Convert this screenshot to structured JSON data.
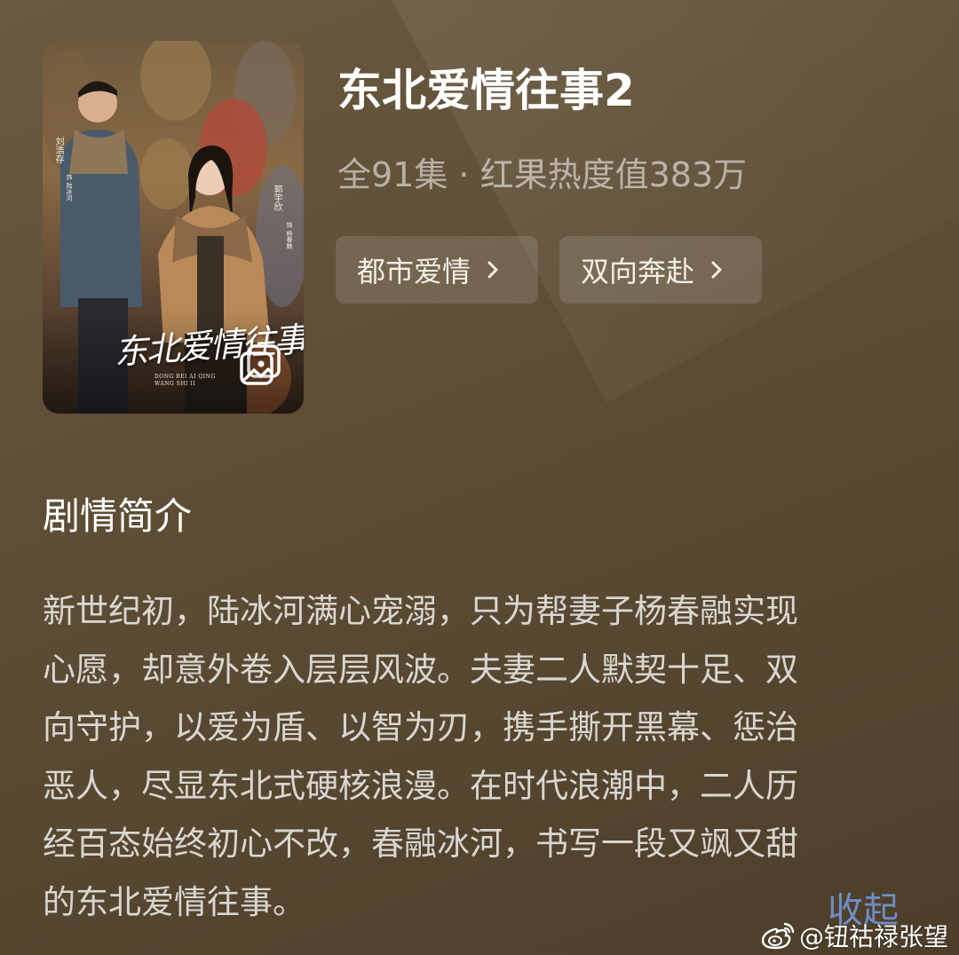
{
  "poster": {
    "title_art": "东北爱情往事2",
    "subtitle_art": "DONG BEI AI QING WANG SHI II",
    "cast_left": "刘浩存",
    "cast_left_role": "饰 陆冰河",
    "cast_right": "郭宇欣",
    "cast_right_role": "饰 杨春融",
    "gallery_icon": "gallery-icon"
  },
  "header": {
    "title": "东北爱情往事2",
    "meta": "全91集 · 红果热度值383万"
  },
  "tags": [
    {
      "label": "都市爱情",
      "icon": "chevron-right-icon"
    },
    {
      "label": "双向奔赴",
      "icon": "chevron-right-icon"
    }
  ],
  "synopsis": {
    "heading": "剧情简介",
    "lines": [
      "新世纪初，陆冰河满心宠溺，只为帮妻子杨春融实现",
      "心愿，却意外卷入层层风波。夫妻二人默契十足、双",
      "向守护，以爱为盾、以智为刃，携手撕开黑幕、惩治",
      "恶人，尽显东北式硬核浪漫。在时代浪潮中，二人历",
      "经百态始终初心不改，春融冰河，书写一段又飒又甜",
      "的东北爱情往事。"
    ],
    "collapse_label": "收起"
  },
  "watermark": {
    "text": "@钮祜禄张望",
    "icon": "weibo-icon"
  },
  "colors": {
    "background": "#5e4e36",
    "link": "#6e8ec8"
  }
}
